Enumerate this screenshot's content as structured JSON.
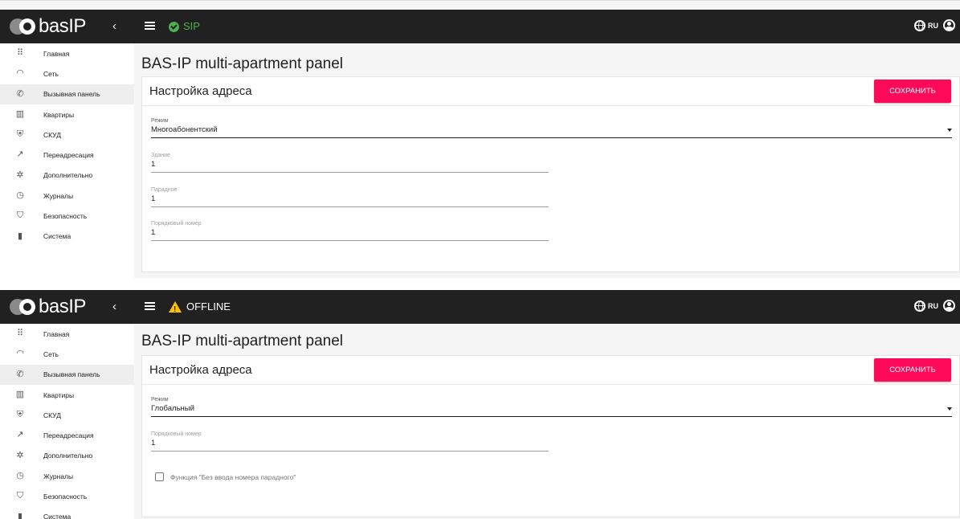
{
  "app": {
    "brand": "basIP",
    "language": "RU",
    "collapse_glyph": "‹",
    "page_title": "BAS-IP multi-apartment panel"
  },
  "colors": {
    "accent": "#ff0a5a",
    "status_ok": "#4caf50",
    "status_warn": "#ffc107",
    "topbar": "#212121"
  },
  "sidebar": {
    "items": [
      {
        "label": "Главная",
        "icon": "apps-icon"
      },
      {
        "label": "Сеть",
        "icon": "wifi-icon"
      },
      {
        "label": "Вызывная панель",
        "icon": "phone-icon",
        "active": true
      },
      {
        "label": "Квартиры",
        "icon": "building-icon"
      },
      {
        "label": "СКУД",
        "icon": "shield-icon"
      },
      {
        "label": "Переадресация",
        "icon": "call-forward-icon"
      },
      {
        "label": "Дополнительно",
        "icon": "gear-icon"
      },
      {
        "label": "Журналы",
        "icon": "history-icon"
      },
      {
        "label": "Безопасность",
        "icon": "security-icon"
      },
      {
        "label": "Система",
        "icon": "device-icon"
      }
    ]
  },
  "card": {
    "title": "Настройка адреса",
    "save_label": "СОХРАНИТЬ"
  },
  "screen1": {
    "status": "SIP",
    "mode": {
      "label": "Режим",
      "value": "Многоабонентский"
    },
    "building": {
      "label": "Здание",
      "value": "1"
    },
    "entrance": {
      "label": "Парадное",
      "value": "1"
    },
    "serial": {
      "label": "Порядковый номер",
      "value": "1"
    }
  },
  "screen2": {
    "status": "OFFLINE",
    "mode": {
      "label": "Режим",
      "value": "Глобальный"
    },
    "serial": {
      "label": "Порядковый номер",
      "value": "1"
    },
    "checkbox": {
      "label": "Функция \"Без ввода номера парадного\"",
      "checked": false
    }
  }
}
